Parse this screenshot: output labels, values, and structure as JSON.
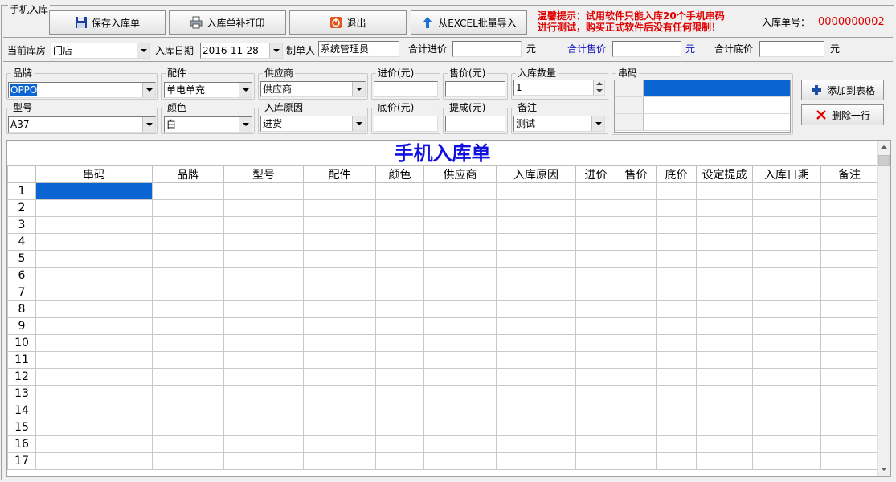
{
  "window": {
    "group_title": "手机入库"
  },
  "toolbar": {
    "save_label": "保存入库单",
    "reprint_label": "入库单补打印",
    "exit_label": "退出",
    "import_label": "从EXCEL批量导入"
  },
  "notice": {
    "line1": "温馨提示：试用软件只能入库20个手机串码",
    "line2": "进行测试，购买正式软件后没有任何限制！"
  },
  "receipt": {
    "no_label": "入库单号：",
    "no_value": "0000000002"
  },
  "header_fields": {
    "warehouse_label": "当前库房",
    "warehouse_value": "门店",
    "date_label": "入库日期",
    "date_value": "2016-11-28",
    "maker_label": "制单人",
    "maker_value": "系统管理员",
    "total_cost_label": "合计进价",
    "total_cost_value": "",
    "total_cost_unit": "元",
    "total_sale_label": "合计售价",
    "total_sale_value": "",
    "total_sale_unit": "元",
    "total_floor_label": "合计底价",
    "total_floor_value": "",
    "total_floor_unit": "元"
  },
  "form": {
    "brand_label": "品牌",
    "brand_value": "OPPO",
    "accessory_label": "配件",
    "accessory_value": "单电单充",
    "supplier_label": "供应商",
    "supplier_value": "供应商",
    "cost_label": "进价(元)",
    "cost_value": "",
    "sale_label": "售价(元)",
    "sale_value": "",
    "qty_label": "入库数量",
    "qty_value": "1",
    "serial_label": "串码",
    "model_label": "型号",
    "model_value": "A37",
    "color_label": "颜色",
    "color_value": "白",
    "reason_label": "入库原因",
    "reason_value": "进货",
    "floor_label": "底价(元)",
    "floor_value": "",
    "commission_label": "提成(元)",
    "commission_value": "",
    "remark_label": "备注",
    "remark_value": "测试",
    "add_label": "添加到表格",
    "delete_label": "删除一行"
  },
  "grid": {
    "title": "手机入库单",
    "columns": [
      "",
      "串码",
      "品牌",
      "型号",
      "配件",
      "颜色",
      "供应商",
      "入库原因",
      "进价",
      "售价",
      "底价",
      "设定提成",
      "入库日期",
      "备注"
    ],
    "row_numbers": [
      "1",
      "2",
      "3",
      "4",
      "5",
      "6",
      "7",
      "8",
      "9",
      "10",
      "11",
      "12",
      "13",
      "14",
      "15",
      "16",
      "17"
    ]
  },
  "colors": {
    "notice": "#e00000",
    "grid_title": "#1010e0",
    "selection": "#0a64d2",
    "receipt_no": "#e00000"
  },
  "icons": [
    "save-icon",
    "printer-icon",
    "exit-icon",
    "up-arrow-icon",
    "plus-icon",
    "x-icon"
  ]
}
